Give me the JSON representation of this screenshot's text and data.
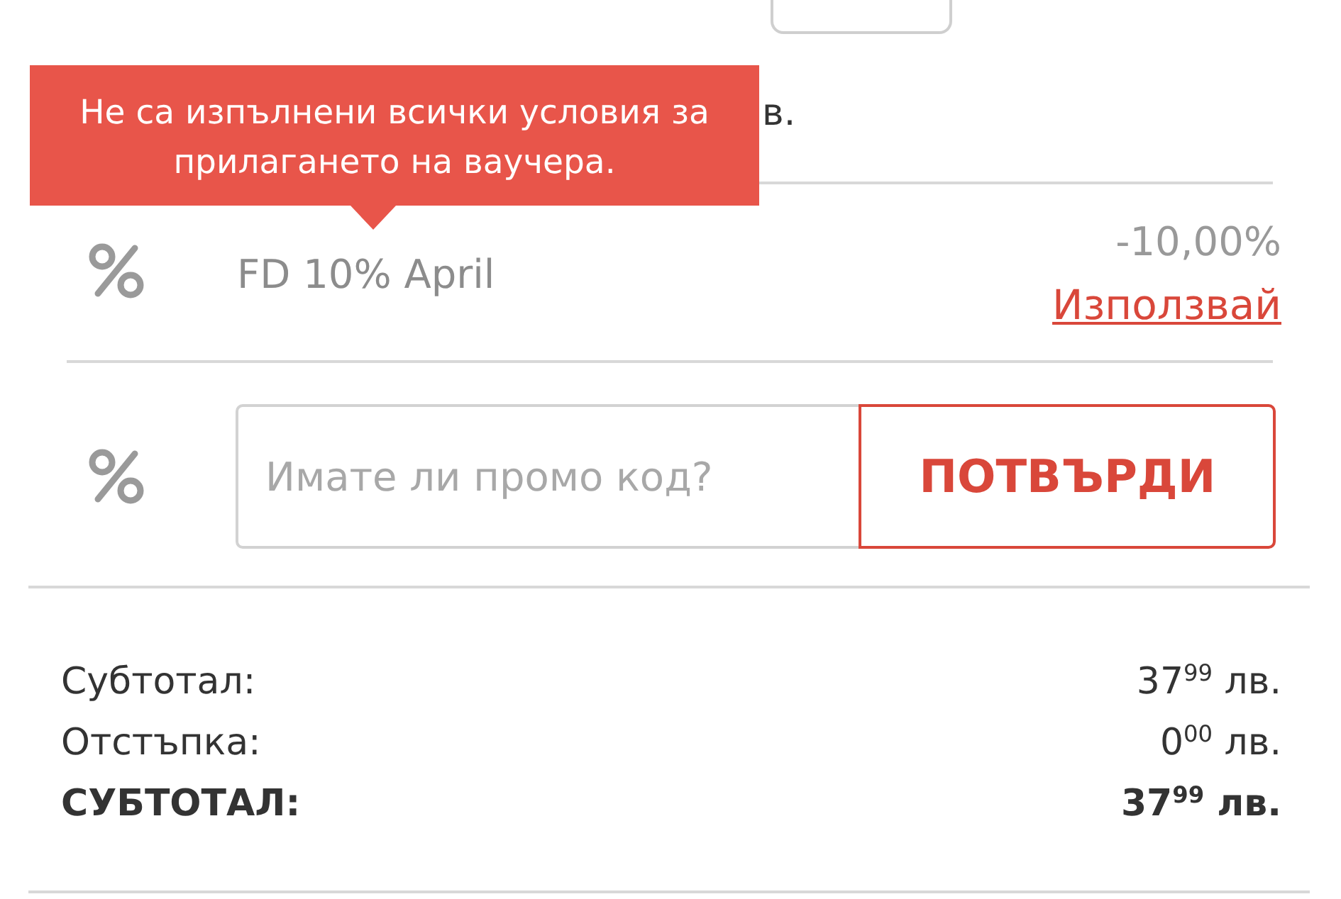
{
  "price_line": {
    "visible_text": "в."
  },
  "tooltip": {
    "message": "Не са изпълнени всички условия за прилагането на ваучера."
  },
  "vouchers": [
    {
      "name": "FD 10% April",
      "discount": "-10,00%",
      "action": "Използвай"
    }
  ],
  "promo_code": {
    "placeholder": "Имате ли промо код?",
    "button": "ПОТВЪРДИ"
  },
  "summary": [
    {
      "kind": "line",
      "label": "Субтотал:",
      "value": "37$^{99}$ лв."
    },
    {
      "kind": "line",
      "label": "Отстъпка:",
      "value": "0$^{00}$ лв."
    },
    {
      "kind": "total",
      "label": "СУБТОТАЛ:",
      "value": "37$^{99}$ лв."
    }
  ]
}
